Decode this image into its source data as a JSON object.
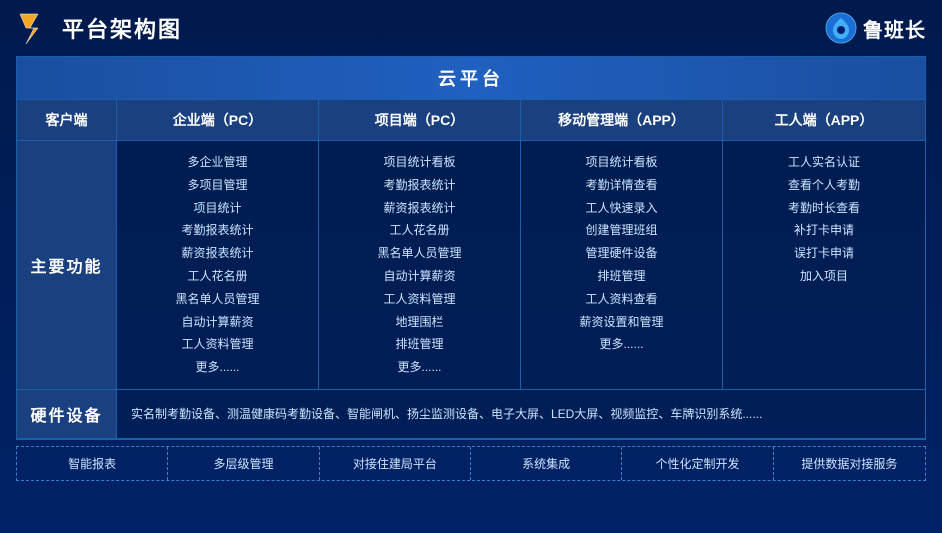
{
  "header": {
    "title": "平台架构图",
    "brand_name": "鲁班长"
  },
  "cloud_platform": "云平台",
  "columns": {
    "client": "客户端",
    "enterprise_pc": "企业端（PC）",
    "project_pc": "项目端（PC）",
    "mobile_app": "移动管理端（APP）",
    "worker_app": "工人端（APP）"
  },
  "main_function_label": "主要功能",
  "enterprise_features": [
    "多企业管理",
    "多项目管理",
    "项目统计",
    "考勤报表统计",
    "薪资报表统计",
    "工人花名册",
    "黑名单人员管理",
    "自动计算薪资",
    "工人资料管理",
    "更多......"
  ],
  "project_features": [
    "项目统计看板",
    "考勤报表统计",
    "薪资报表统计",
    "工人花名册",
    "黑名单人员管理",
    "自动计算薪资",
    "工人资料管理",
    "地理围栏",
    "排班管理",
    "更多......"
  ],
  "mobile_features": [
    "项目统计看板",
    "考勤详情查看",
    "工人快速录入",
    "创建管理班组",
    "管理硬件设备",
    "排班管理",
    "工人资料查看",
    "薪资设置和管理",
    "更多......"
  ],
  "worker_features": [
    "工人实名认证",
    "查看个人考勤",
    "考勤时长查看",
    "补打卡申请",
    "误打卡申请",
    "加入项目"
  ],
  "hardware_label": "硬件设备",
  "hardware_content": "实名制考勤设备、测温健康码考勤设备、智能闸机、扬尘监测设备、电子大屏、LED大屏、视频监控、车牌识别系统......",
  "features": [
    "智能报表",
    "多层级管理",
    "对接住建局平台",
    "系统集成",
    "个性化定制开发",
    "提供数据对接服务"
  ]
}
